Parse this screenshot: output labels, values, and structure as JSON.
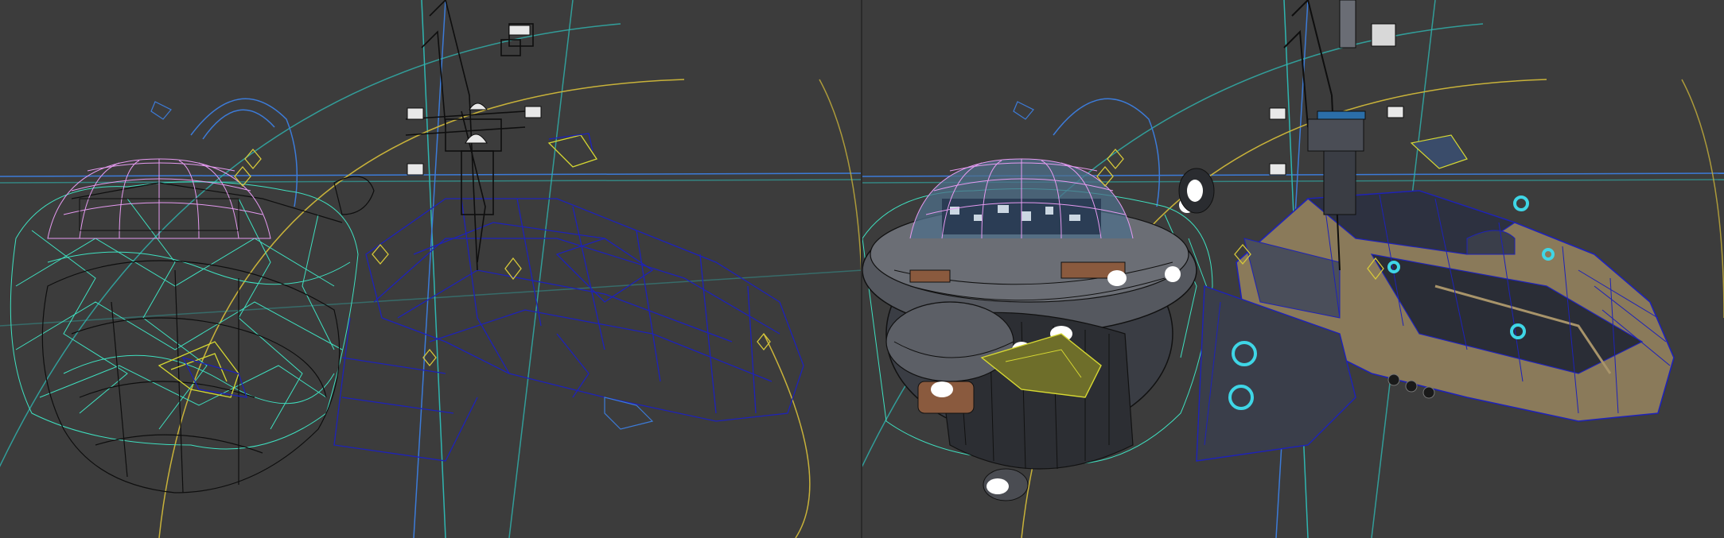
{
  "scene": {
    "panes": [
      {
        "mode": "wireframe",
        "name": "viewport-wireframe"
      },
      {
        "mode": "shaded-wireframe",
        "name": "viewport-shaded"
      }
    ]
  },
  "colors": {
    "background": "#3c3c3c",
    "guide_cyan": "#2fb5b0",
    "guide_blue": "#3c7bd8",
    "guide_yellow": "#c8b23a",
    "mesh_teal": "#3fe0c0",
    "mesh_violet": "#e59af0",
    "mesh_navy": "#1e22b8",
    "mesh_black": "#0e0e0e",
    "mesh_yellow": "#d6d832"
  },
  "icons": [
    "helper-point-icon",
    "camera-target-icon"
  ]
}
